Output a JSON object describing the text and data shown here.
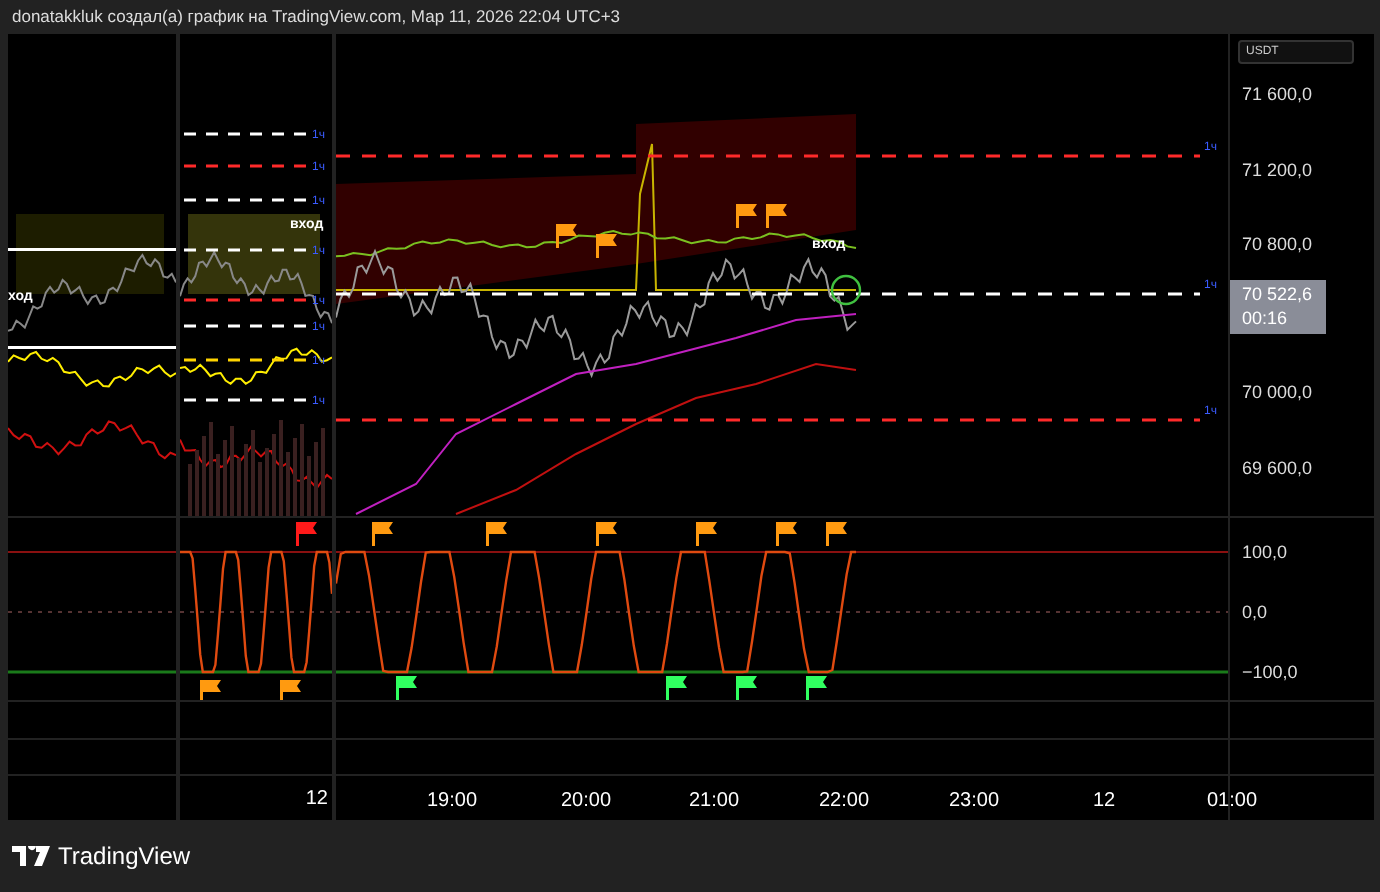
{
  "header": {
    "text": "donatakkluk создал(а) график на TradingView.com, Мар 11, 2026 22:04 UTC+3"
  },
  "side_panes": [
    {
      "signal_label": "ход"
    },
    {
      "signal_label": "вход",
      "time_label": "12",
      "levels": [
        {
          "label": "1ч",
          "color": "#ffffff"
        },
        {
          "label": "1ч",
          "color": "#ff2a2a"
        },
        {
          "label": "1ч",
          "color": "#ffffff"
        },
        {
          "label": "1ч",
          "color": "#ffffff"
        },
        {
          "label": "1ч",
          "color": "#ff2a2a"
        },
        {
          "label": "1ч",
          "color": "#ffffff"
        },
        {
          "label": "1ч",
          "color": "#ffd400"
        },
        {
          "label": "1ч",
          "color": "#ffffff"
        }
      ]
    }
  ],
  "main_chart": {
    "currency": "USDT",
    "signal_label": "вход",
    "levels": [
      {
        "label": "1ч",
        "color": "#ff2a2a"
      },
      {
        "label": "1ч",
        "color": "#ffffff"
      },
      {
        "label": "1ч",
        "color": "#ff2a2a"
      }
    ],
    "price_ticks": [
      "71 600,0",
      "71 200,0",
      "70 800,0",
      "70 000,0",
      "69 600,0"
    ],
    "last_price": {
      "value": "70 522,6",
      "countdown": "00:16"
    },
    "oscillator_ticks": [
      "100,0",
      "0,0",
      "−100,0"
    ]
  },
  "time_axis": [
    "19:00",
    "20:00",
    "21:00",
    "22:00",
    "23:00",
    "12",
    "01:00"
  ],
  "footer": {
    "brand": "TradingView"
  }
}
